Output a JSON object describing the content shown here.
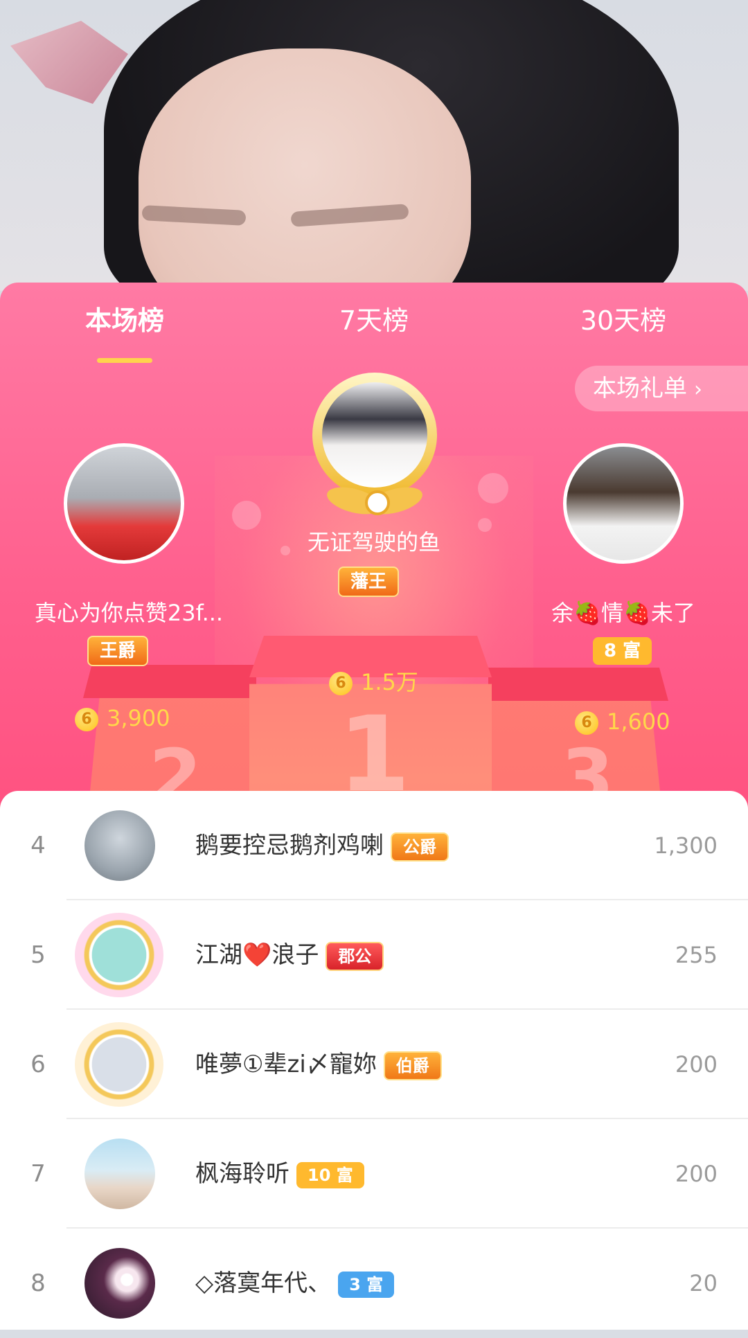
{
  "tabs": [
    {
      "label": "本场榜",
      "active": true
    },
    {
      "label": "7天榜",
      "active": false
    },
    {
      "label": "30天榜",
      "active": false
    }
  ],
  "gift_list_link": {
    "label": "本场礼单",
    "icon": "chevron-right-icon"
  },
  "top3": [
    {
      "rank": 1,
      "name": "无证驾驶的鱼",
      "badge": "藩王",
      "score": "1.5万"
    },
    {
      "rank": 2,
      "name": "真心为你点赞23f...",
      "badge": "王爵",
      "score": "3,900"
    },
    {
      "rank": 3,
      "name": "余🍓情🍓未了",
      "badge": "8 富",
      "score": "1,600"
    }
  ],
  "podium_numbers": [
    "1",
    "2",
    "3"
  ],
  "coin_symbol": "6",
  "list": [
    {
      "rank": "4",
      "name": "鹅要控忌鹅剂鸡喇",
      "badge": "公爵",
      "amount": "1,300"
    },
    {
      "rank": "5",
      "name": "江湖❤️浪子",
      "badge": "郡公",
      "amount": "255"
    },
    {
      "rank": "6",
      "name": "唯夢①辈zi〆寵妳",
      "badge": "伯爵",
      "amount": "200"
    },
    {
      "rank": "7",
      "name": "枫海聆听",
      "badge": "10 富",
      "amount": "200"
    },
    {
      "rank": "8",
      "name": "◇落寞年代、",
      "badge": "3 富",
      "amount": "20"
    }
  ],
  "colors": {
    "panel_pink": "#ff5f8d",
    "tab_indicator": "#ffd34d",
    "score_gold": "#ffd84a",
    "rich_badge": "#ffb92e",
    "rich_badge_blue": "#4aa5ef"
  }
}
